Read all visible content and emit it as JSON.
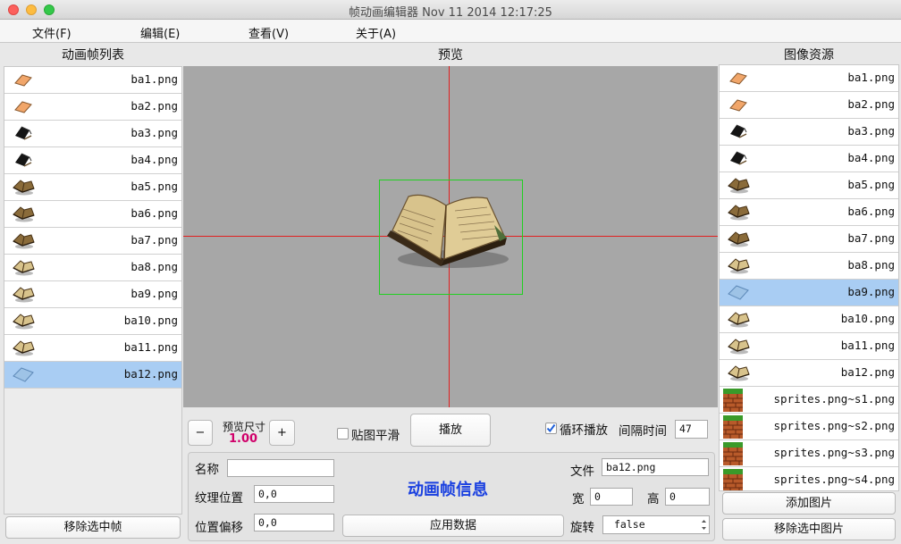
{
  "window": {
    "title": "帧动画编辑器 Nov 11 2014 12:17:25"
  },
  "menu": [
    "文件(F)",
    "编辑(E)",
    "查看(V)",
    "关于(A)"
  ],
  "left_panel": {
    "title": "动画帧列表",
    "items": [
      "ba1.png",
      "ba2.png",
      "ba3.png",
      "ba4.png",
      "ba5.png",
      "ba6.png",
      "ba7.png",
      "ba8.png",
      "ba9.png",
      "ba10.png",
      "ba11.png",
      "ba12.png"
    ],
    "selected_index": 11,
    "remove_button": "移除选中帧"
  },
  "preview": {
    "title": "预览"
  },
  "right_panel": {
    "title": "图像资源",
    "items": [
      "ba1.png",
      "ba2.png",
      "ba3.png",
      "ba4.png",
      "ba5.png",
      "ba6.png",
      "ba7.png",
      "ba8.png",
      "ba9.png",
      "ba10.png",
      "ba11.png",
      "ba12.png",
      "sprites.png~s1.png",
      "sprites.png~s2.png",
      "sprites.png~s3.png",
      "sprites.png~s4.png"
    ],
    "selected_index": 8,
    "add_button": "添加图片",
    "remove_button": "移除选中图片"
  },
  "controls": {
    "minus": "−",
    "plus": "+",
    "preview_size_label": "预览尺寸",
    "preview_size_value": "1.00",
    "smooth_label": "贴图平滑",
    "smooth_checked": false,
    "play_button": "播放",
    "loop_label": "循环播放",
    "loop_checked": true,
    "interval_label": "间隔时间",
    "interval_value": "47"
  },
  "frame_info": {
    "heading": "动画帧信息",
    "name_label": "名称",
    "name_value": "",
    "texture_pos_label": "纹理位置",
    "texture_pos_value": "0,0",
    "offset_label": "位置偏移",
    "offset_value": "0,0",
    "apply_button": "应用数据",
    "file_label": "文件",
    "file_value": "ba12.png",
    "width_label": "宽",
    "width_value": "0",
    "height_label": "高",
    "height_value": "0",
    "rotate_label": "旋转",
    "rotate_value": "false"
  },
  "colors": {
    "selection": "#a9cdf3",
    "crosshair": "#e02020",
    "frame_box": "#20d020",
    "accent_text": "#1a40e0",
    "size_value": "#d0006a"
  }
}
